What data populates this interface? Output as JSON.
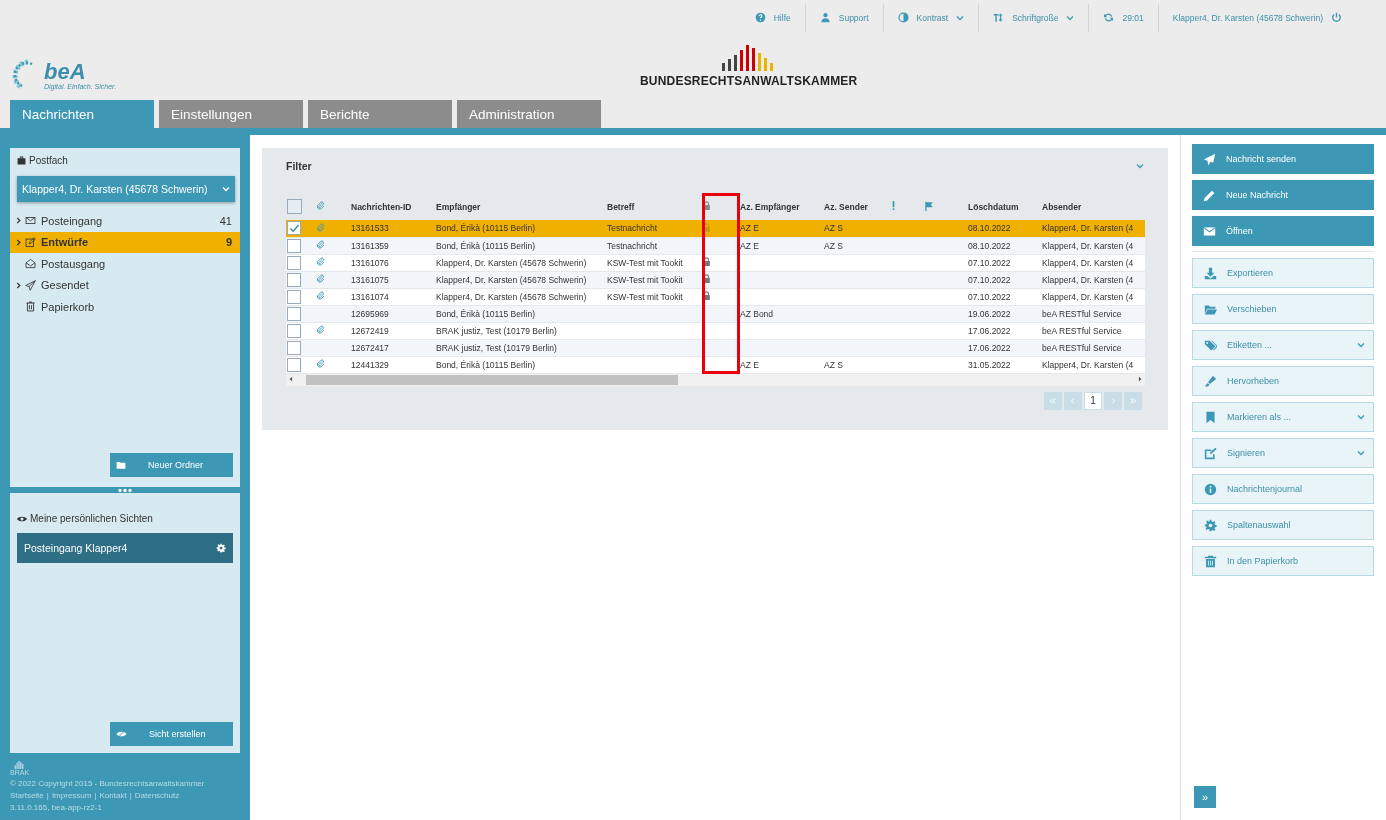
{
  "top_bar": [
    {
      "label": "Hilfe",
      "dropdown": false
    },
    {
      "label": "Support",
      "dropdown": false
    },
    {
      "label": "Kontrast",
      "dropdown": true
    },
    {
      "label": "Schriftgroße",
      "dropdown": true
    },
    {
      "label": "29:01",
      "dropdown": false
    },
    {
      "label": "Klapper4, Dr. Karsten (45678 Schwerin)",
      "dropdown": false
    }
  ],
  "brand": {
    "logo_text": "beA",
    "logo_tagline": "Digital. Einfach. Sicher.",
    "chamber": "BUNDESRECHTSANWALTSKAMMER"
  },
  "tabs": [
    {
      "label": "Nachrichten",
      "selected": true
    },
    {
      "label": "Einstellungen",
      "selected": false
    },
    {
      "label": "Berichte",
      "selected": false
    },
    {
      "label": "Administration",
      "selected": false
    }
  ],
  "sidebar": {
    "title": "Postfach",
    "mailbox": "Klapper4, Dr. Karsten (45678 Schwerin)",
    "folders": [
      {
        "label": "Posteingang",
        "count": "41",
        "expandable": true,
        "selected": false
      },
      {
        "label": "Entwürfe",
        "count": "9",
        "expandable": true,
        "selected": true
      },
      {
        "label": "Postausgang",
        "expandable": false,
        "selected": false
      },
      {
        "label": "Gesendet",
        "expandable": true,
        "selected": false
      },
      {
        "label": "Papierkorb",
        "expandable": false,
        "selected": false
      }
    ],
    "new_folder_button": "Neuer Ordner",
    "views_title": "Meine persönlichen Sichten",
    "views": [
      {
        "label": "Posteingang Klapper4"
      }
    ],
    "create_view_button": "Sicht erstellen"
  },
  "footer": {
    "logo": "BRAK",
    "copyright": "© 2022 Copyright 2015 - Bundesrechtsanwaltskammer",
    "links": [
      "Startseite",
      "Impressum",
      "Kontakt",
      "Datenschutz"
    ],
    "link_separator": "|",
    "version": "3.11.0.165, bea-app-rz2-1"
  },
  "filter": {
    "title": "Filter"
  },
  "table": {
    "select_all": {
      "checked": false
    },
    "columns": [
      {
        "kind": "check",
        "highlighted": false
      },
      {
        "kind": "attachment",
        "highlighted": false
      },
      {
        "kind": "text",
        "label": "Nachrichten-ID",
        "highlighted": false
      },
      {
        "kind": "text",
        "label": "Empfänger",
        "highlighted": false
      },
      {
        "kind": "text",
        "label": "Betreff",
        "highlighted": false
      },
      {
        "kind": "lock",
        "highlighted": true
      },
      {
        "kind": "text",
        "label": "Az. Empfänger",
        "highlighted": false
      },
      {
        "kind": "text",
        "label": "Az. Sender",
        "highlighted": false
      },
      {
        "kind": "priority",
        "highlighted": false
      },
      {
        "kind": "flag",
        "highlighted": false
      },
      {
        "kind": "text",
        "label": "Löschdatum",
        "highlighted": false
      },
      {
        "kind": "text",
        "label": "Absender",
        "highlighted": false
      }
    ],
    "rows": [
      {
        "checked": true,
        "selected": true,
        "attachment": true,
        "id": "13161533",
        "recipient": "Bond, Érikà (10115 Berlin)",
        "subject": "Testnachricht",
        "locked": true,
        "az_recipient": "AZ E",
        "az_sender": "AZ S",
        "delete_date": "08.10.2022",
        "sender": "Klapper4, Dr. Karsten (4"
      },
      {
        "checked": false,
        "selected": false,
        "attachment": true,
        "id": "13161359",
        "recipient": "Bond, Érikà (10115 Berlin)",
        "subject": "Testnachricht",
        "locked": false,
        "az_recipient": "AZ E",
        "az_sender": "AZ S",
        "delete_date": "08.10.2022",
        "sender": "Klapper4, Dr. Karsten (4"
      },
      {
        "checked": false,
        "selected": false,
        "attachment": true,
        "id": "13161076",
        "recipient": "Klapper4, Dr. Karsten (45678 Schwerin)",
        "subject": "KSW-Test mit Tookit",
        "locked": true,
        "delete_date": "07.10.2022",
        "sender": "Klapper4, Dr. Karsten (4"
      },
      {
        "checked": false,
        "selected": false,
        "attachment": true,
        "id": "13161075",
        "recipient": "Klapper4, Dr. Karsten (45678 Schwerin)",
        "subject": "KSW-Test mit Tookit",
        "locked": true,
        "delete_date": "07.10.2022",
        "sender": "Klapper4, Dr. Karsten (4"
      },
      {
        "checked": false,
        "selected": false,
        "attachment": true,
        "id": "13161074",
        "recipient": "Klapper4, Dr. Karsten (45678 Schwerin)",
        "subject": "KSW-Test mit Tookit",
        "locked": true,
        "delete_date": "07.10.2022",
        "sender": "Klapper4, Dr. Karsten (4"
      },
      {
        "checked": false,
        "selected": false,
        "attachment": false,
        "id": "12695969",
        "recipient": "Bond, Érikà (10115 Berlin)",
        "locked": false,
        "az_recipient": "AZ Bond",
        "delete_date": "19.06.2022",
        "sender": "beA RESTful Service"
      },
      {
        "checked": false,
        "selected": false,
        "attachment": true,
        "id": "12672419",
        "recipient": "BRAK justiz, Test (10179 Berlin)",
        "locked": false,
        "delete_date": "17.06.2022",
        "sender": "beA RESTful Service"
      },
      {
        "checked": false,
        "selected": false,
        "attachment": false,
        "id": "12672417",
        "recipient": "BRAK justiz, Test (10179 Berlin)",
        "locked": false,
        "delete_date": "17.06.2022",
        "sender": "beA RESTful Service"
      },
      {
        "checked": false,
        "selected": false,
        "attachment": true,
        "id": "12441329",
        "recipient": "Bond, Érikà (10115 Berlin)",
        "locked": false,
        "az_recipient": "AZ E",
        "az_sender": "AZ S",
        "delete_date": "31.05.2022",
        "sender": "Klapper4, Dr. Karsten (4"
      }
    ]
  },
  "pager": [
    {
      "kind": "first",
      "selected": false
    },
    {
      "kind": "prev",
      "selected": false
    },
    {
      "kind": "page",
      "label": "1",
      "selected": true
    },
    {
      "kind": "next",
      "selected": false
    },
    {
      "kind": "last",
      "selected": false
    }
  ],
  "actions": [
    {
      "kind": "primary",
      "label": "Nachricht senden",
      "dropdown": false
    },
    {
      "kind": "primary",
      "label": "Neue Nachricht",
      "dropdown": false
    },
    {
      "kind": "primary",
      "label": "Öffnen",
      "dropdown": false
    },
    {
      "kind": "secondary",
      "label": "Exportieren",
      "dropdown": false
    },
    {
      "kind": "secondary",
      "label": "Verschieben",
      "dropdown": false
    },
    {
      "kind": "secondary",
      "label": "Etiketten ...",
      "dropdown": true
    },
    {
      "kind": "secondary",
      "label": "Hervorheben",
      "dropdown": false
    },
    {
      "kind": "secondary",
      "label": "Markieren als ...",
      "dropdown": true
    },
    {
      "kind": "secondary",
      "label": "Signieren",
      "dropdown": true
    },
    {
      "kind": "secondary",
      "label": "Nachrichtenjournal",
      "dropdown": false
    },
    {
      "kind": "secondary",
      "label": "Spaltenauswahl",
      "dropdown": false
    },
    {
      "kind": "secondary",
      "label": "In den Papierkorb",
      "dropdown": false
    }
  ],
  "collapse_button": "»"
}
